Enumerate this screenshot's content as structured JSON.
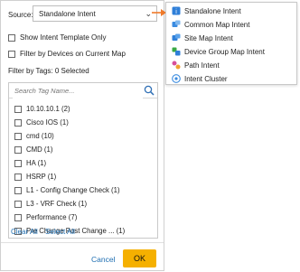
{
  "source": {
    "label": "Source:",
    "selected": "Standalone Intent"
  },
  "options": {
    "show_template_only": "Show Intent Template Only",
    "filter_by_devices": "Filter by Devices on Current Map"
  },
  "filter": {
    "label": "Filter by Tags: 0 Selected"
  },
  "search": {
    "placeholder": "Search Tag Name..."
  },
  "tags": [
    "10.10.10.1 (2)",
    "Cisco IOS (1)",
    "cmd (10)",
    "CMD (1)",
    "HA (1)",
    "HSRP (1)",
    "L1 - Config Change Check (1)",
    "L3 - VRF Check (1)",
    "Performance (7)",
    "Pre Change Post Change ... (1)"
  ],
  "links": {
    "clear_all": "Clear All",
    "select_all": "Select All"
  },
  "footer": {
    "cancel": "Cancel",
    "ok": "OK"
  },
  "menu": [
    {
      "label": "Standalone Intent",
      "icon": "standalone-intent-icon",
      "color": "#2f7fd8"
    },
    {
      "label": "Common Map Intent",
      "icon": "common-map-intent-icon",
      "color": "#3a8be0"
    },
    {
      "label": "Site Map Intent",
      "icon": "site-map-intent-icon",
      "color": "#2f7fd8"
    },
    {
      "label": "Device Group Map Intent",
      "icon": "device-group-map-intent-icon",
      "color": "#3aa845"
    },
    {
      "label": "Path Intent",
      "icon": "path-intent-icon",
      "color": "#d64f9a"
    },
    {
      "label": "Intent Cluster",
      "icon": "intent-cluster-icon",
      "color": "#3a8be0"
    }
  ],
  "colors": {
    "accent_ok": "#f5b000",
    "link": "#1f6fb2",
    "arrow": "#f07a2a"
  }
}
